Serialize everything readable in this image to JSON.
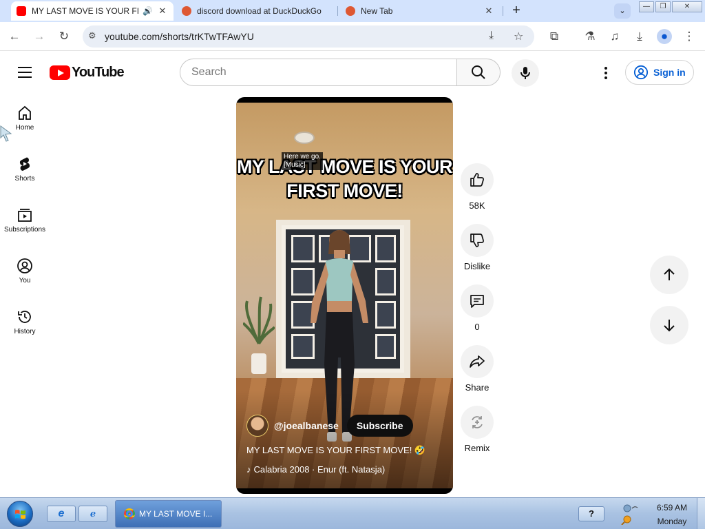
{
  "browser": {
    "tabs": [
      {
        "title": "MY LAST MOVE IS YOUR FIRST MOVE! 🤣 #shorts",
        "favicon_color": "#ff0000"
      },
      {
        "title": "discord download at DuckDuckGo",
        "favicon_color": "#de5833"
      },
      {
        "title": "New Tab",
        "favicon_color": "#de5833"
      }
    ],
    "url": "youtube.com/shorts/trKTwTFAwYU"
  },
  "youtube": {
    "logo_text": "YouTube",
    "search_placeholder": "Search",
    "sign_in": "Sign in",
    "sidebar": [
      {
        "label": "Home",
        "icon": "home-icon"
      },
      {
        "label": "Shorts",
        "icon": "shorts-icon"
      },
      {
        "label": "Subscriptions",
        "icon": "subscriptions-icon"
      },
      {
        "label": "You",
        "icon": "you-icon"
      },
      {
        "label": "History",
        "icon": "history-icon"
      }
    ]
  },
  "short": {
    "overlay_text": "MY LAST MOVE IS YOUR FIRST MOVE!",
    "closed_caption": "Here we go.\n[Music]",
    "channel_handle": "@joealbanese",
    "subscribe_label": "Subscribe",
    "caption": "MY LAST MOVE IS YOUR FIRST MOVE! 🤣",
    "music": "Calabria 2008 · Enur (ft. Natasja)"
  },
  "actions": {
    "likes": "58K",
    "dislike": "Dislike",
    "comments": "0",
    "share": "Share",
    "remix": "Remix"
  },
  "taskbar": {
    "active_window": "MY LAST MOVE I...",
    "time": "6:59 AM",
    "day": "Monday",
    "help_label": "?"
  },
  "colors": {
    "youtube_red": "#ff0000",
    "link_blue": "#065fd4",
    "tab_strip": "#d3e3fd"
  }
}
